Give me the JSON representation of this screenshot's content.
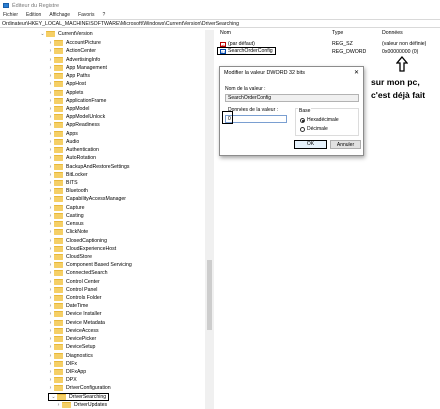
{
  "window": {
    "title": "Éditeur du Registre"
  },
  "menu": [
    "Fichier",
    "Edition",
    "Affichage",
    "Favoris",
    "?"
  ],
  "address": "Ordinateur\\HKEY_LOCAL_MACHINE\\SOFTWARE\\Microsoft\\Windows\\CurrentVersion\\DriverSearching",
  "tree": {
    "items": [
      {
        "label": "CurrentVersion"
      },
      {
        "label": "AccountPicture"
      },
      {
        "label": "ActionCenter"
      },
      {
        "label": "AdvertisingInfo"
      },
      {
        "label": "App Management"
      },
      {
        "label": "App Paths"
      },
      {
        "label": "AppHost"
      },
      {
        "label": "Applets"
      },
      {
        "label": "ApplicationFrame"
      },
      {
        "label": "AppModel"
      },
      {
        "label": "AppModelUnlock"
      },
      {
        "label": "AppReadiness"
      },
      {
        "label": "Apps"
      },
      {
        "label": "Audio"
      },
      {
        "label": "Authentication"
      },
      {
        "label": "AutoRotation"
      },
      {
        "label": "BackupAndRestoreSettings"
      },
      {
        "label": "BitLocker"
      },
      {
        "label": "BITS"
      },
      {
        "label": "Bluetooth"
      },
      {
        "label": "CapabilityAccessManager"
      },
      {
        "label": "Capture"
      },
      {
        "label": "Casting"
      },
      {
        "label": "Census"
      },
      {
        "label": "ClickNote"
      },
      {
        "label": "ClosedCaptioning"
      },
      {
        "label": "CloudExperienceHost"
      },
      {
        "label": "CloudStore"
      },
      {
        "label": "Component Based Servicing"
      },
      {
        "label": "ConnectedSearch"
      },
      {
        "label": "Control Center"
      },
      {
        "label": "Control Panel"
      },
      {
        "label": "Controls Folder"
      },
      {
        "label": "DateTime"
      },
      {
        "label": "Device Installer"
      },
      {
        "label": "Device Metadata"
      },
      {
        "label": "DeviceAccess"
      },
      {
        "label": "DevicePicker"
      },
      {
        "label": "DeviceSetup"
      },
      {
        "label": "Diagnostics"
      },
      {
        "label": "DIFx"
      },
      {
        "label": "DIFxApp"
      },
      {
        "label": "DPX"
      },
      {
        "label": "DriverConfiguration"
      },
      {
        "label": "DriverSearching"
      },
      {
        "label": "DriverUpdates"
      },
      {
        "label": "Plugin"
      }
    ]
  },
  "values": {
    "headers": {
      "name": "Nom",
      "type": "Type",
      "data": "Données"
    },
    "rows": [
      {
        "name": "(par défaut)",
        "type": "REG_SZ",
        "data": "(valeur non définie)",
        "icon": "string-value-icon"
      },
      {
        "name": "SearchOrderConfig",
        "type": "REG_DWORD",
        "data": "0x00000000 (0)",
        "icon": "binary-value-icon"
      }
    ]
  },
  "dialog": {
    "title": "Modifier la valeur DWORD 32 bits",
    "close": "✕",
    "name_label": "Nom de la valeur :",
    "name_value": "SearchOrderConfig",
    "data_label": "Données de la valeur :",
    "data_value": "0",
    "base_label": "Base",
    "hex_label": "Hexadécimale",
    "dec_label": "Décimale",
    "selected_base": "hex",
    "ok_label": "OK",
    "cancel_label": "Annuler"
  },
  "annotation": {
    "line1": "sur mon pc,",
    "line2": "c'est déjà fait"
  }
}
